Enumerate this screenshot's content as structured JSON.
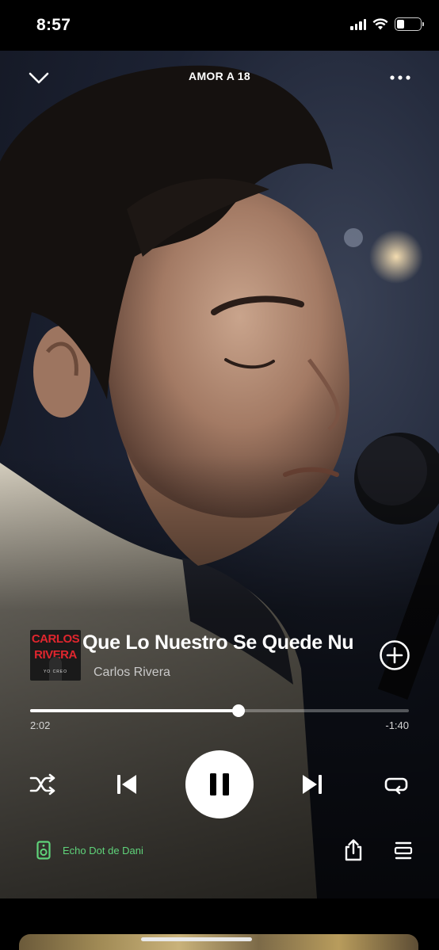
{
  "status_bar": {
    "time": "8:57",
    "signal_bars": 4,
    "battery_level": 0.35
  },
  "header": {
    "title": "AMOR A 18"
  },
  "album_art": {
    "line1": "CARLOS",
    "line2": "RIVERA",
    "sub": "YO CREO"
  },
  "track": {
    "title": "Que Lo Nuestro Se Quede Nu",
    "artist": "Carlos Rivera"
  },
  "progress": {
    "elapsed": "2:02",
    "remaining": "-1:40",
    "fraction": 0.55
  },
  "device": {
    "label": "Echo Dot de Dani"
  },
  "colors": {
    "accent_green": "#5fd37a",
    "background": "#000000"
  },
  "icons": {
    "collapse": "chevron-down-icon",
    "more": "more-horizontal-icon",
    "add": "plus-circle-icon",
    "shuffle": "shuffle-icon",
    "previous": "skip-previous-icon",
    "pause": "pause-icon",
    "next": "skip-next-icon",
    "repeat": "repeat-icon",
    "device": "speaker-icon",
    "share": "share-icon",
    "queue": "queue-icon"
  }
}
